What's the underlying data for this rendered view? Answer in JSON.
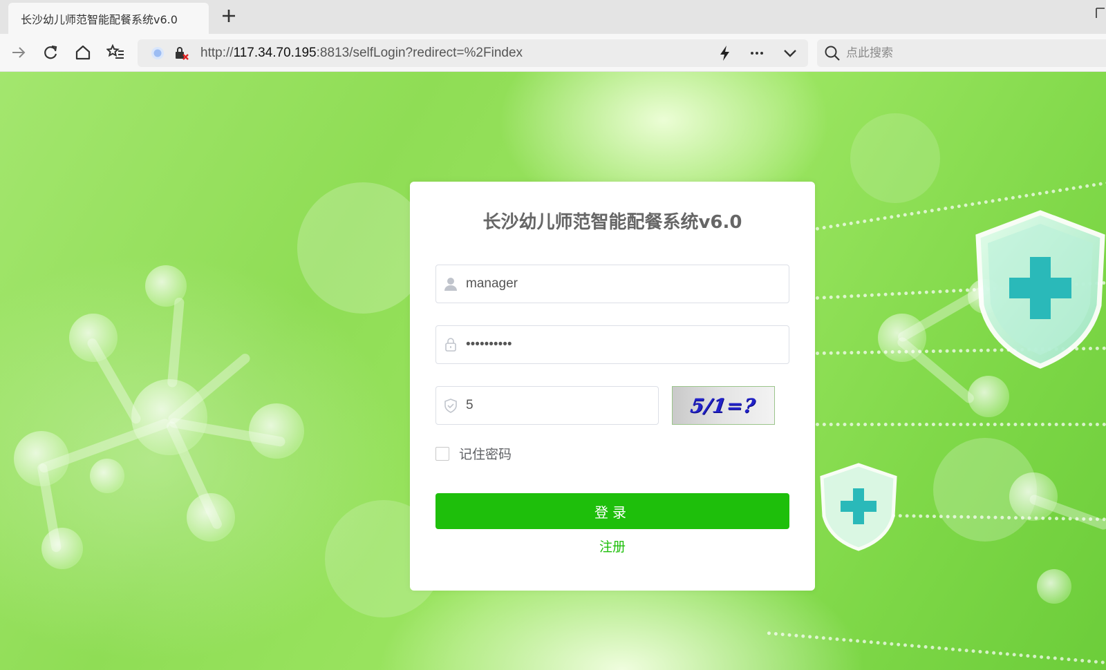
{
  "browser": {
    "tab_title": "长沙幼儿师范智能配餐系统v6.0",
    "url_scheme": "http://",
    "url_host": "117.34.70.195",
    "url_rest": ":8813/selfLogin?redirect=%2Findex",
    "search_placeholder": "点此搜索"
  },
  "login": {
    "title": "长沙幼儿师范智能配餐系统v6.0",
    "username_value": "manager",
    "password_value": "••••••••••",
    "captcha_value": "5",
    "captcha_image_text": "5/1=?",
    "remember_label": "记住密码",
    "login_label": "登录",
    "register_label": "注册"
  },
  "colors": {
    "accent_green": "#1ebf0b",
    "background_green": "#8fdd55"
  },
  "icons": [
    "forward-icon",
    "reload-icon",
    "home-icon",
    "favorites-icon",
    "lightning-icon",
    "more-icon",
    "chevron-down-icon",
    "search-icon",
    "user-icon",
    "lock-icon",
    "shield-check-icon"
  ]
}
